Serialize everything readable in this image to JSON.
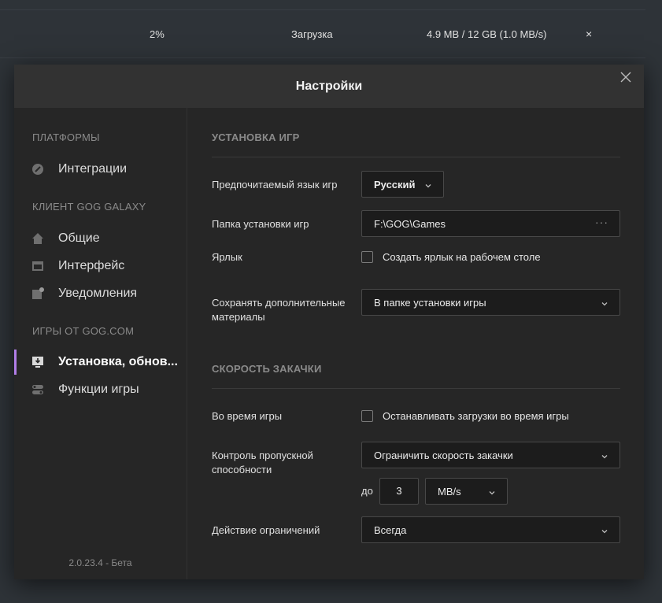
{
  "download_bar": {
    "percent": "2%",
    "status": "Загрузка",
    "size": "4.9 MB / 12 GB (1.0 MB/s)",
    "cancel": "×"
  },
  "modal": {
    "title": "Настройки",
    "close_icon": "close-icon"
  },
  "sidebar": {
    "groups": [
      {
        "label": "ПЛАТФОРМЫ"
      },
      {
        "label": "КЛИЕНТ GOG GALAXY"
      },
      {
        "label": "ИГРЫ ОТ GOG.COM"
      }
    ],
    "items": [
      {
        "label": "Интеграции",
        "icon": "integrations-icon"
      },
      {
        "label": "Общие",
        "icon": "home-icon"
      },
      {
        "label": "Интерфейс",
        "icon": "window-icon"
      },
      {
        "label": "Уведомления",
        "icon": "notification-icon"
      },
      {
        "label": "Установка, обнов...",
        "icon": "install-icon",
        "active": true
      },
      {
        "label": "Функции игры",
        "icon": "toggles-icon"
      }
    ],
    "version": "2.0.23.4 - Бета"
  },
  "install_section": {
    "title": "УСТАНОВКА ИГР",
    "language": {
      "label": "Предпочитаемый язык игр",
      "value": "Русский"
    },
    "folder": {
      "label": "Папка установки игр",
      "value": "F:\\GOG\\Games",
      "more": "···"
    },
    "shortcut": {
      "label": "Ярлык",
      "checkbox_label": "Создать ярлык на рабочем столе",
      "checked": false
    },
    "extras": {
      "label": "Сохранять дополнительные материалы",
      "value": "В папке установки игры"
    }
  },
  "speed_section": {
    "title": "СКОРОСТЬ ЗАКАЧКИ",
    "ingame": {
      "label": "Во время игры",
      "checkbox_label": "Останавливать загрузки во время игры",
      "checked": false
    },
    "bandwidth": {
      "label": "Контроль пропускной способности",
      "value": "Ограничить скорость закачки"
    },
    "limit": {
      "prefix": "до",
      "amount": "3",
      "unit": "MB/s"
    },
    "limit_action": {
      "label": "Действие ограничений",
      "value": "Всегда"
    }
  },
  "colors": {
    "accent": "#b17ee8",
    "background": "#2e3338",
    "modal": "#262626"
  }
}
